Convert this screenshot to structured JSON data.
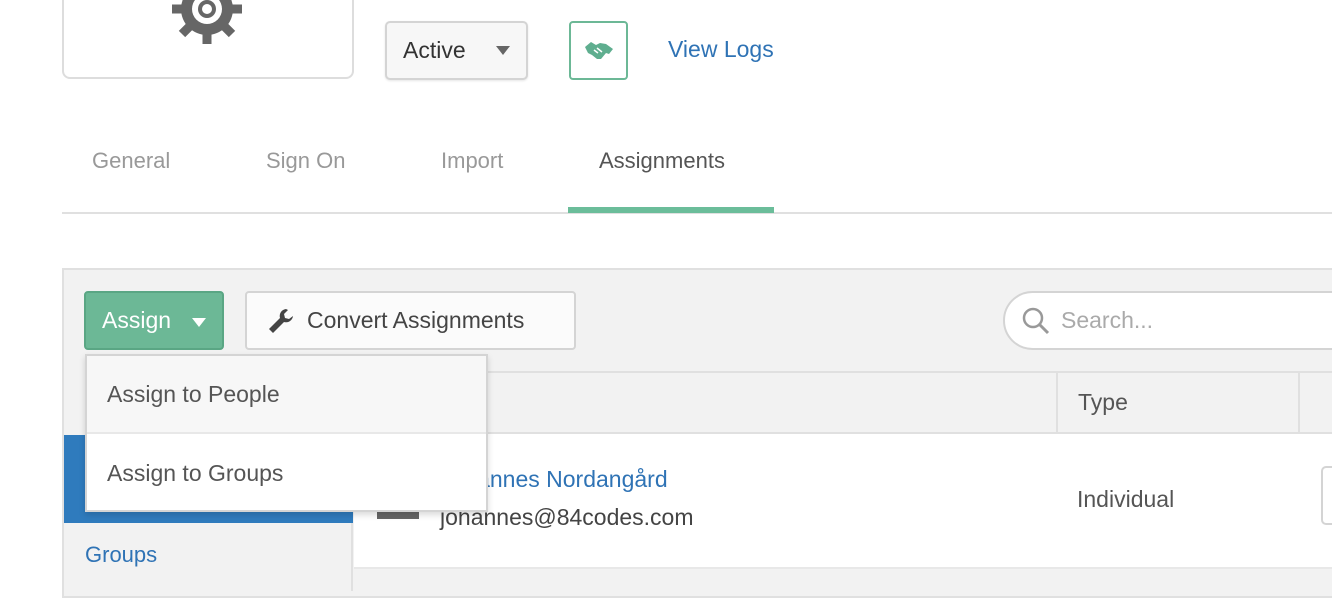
{
  "header": {
    "status_select": "Active",
    "view_logs": "View Logs",
    "icons": {
      "app": "gear-icon",
      "provisioning": "handshake-icon"
    }
  },
  "tabs": [
    {
      "label": "General"
    },
    {
      "label": "Sign On"
    },
    {
      "label": "Import"
    },
    {
      "label": "Assignments",
      "active": true
    }
  ],
  "toolbar": {
    "assign": "Assign",
    "convert": "Convert Assignments",
    "search_placeholder": "Search..."
  },
  "dropdown": {
    "items": [
      "Assign to People",
      "Assign to Groups"
    ]
  },
  "sidebar": {
    "items": [
      {
        "label": "Groups"
      }
    ]
  },
  "table": {
    "headers": [
      "Type"
    ],
    "rows": [
      {
        "name": "Johannes Nordangård",
        "email": "johannes@84codes.com",
        "type": "Individual"
      }
    ]
  },
  "colors": {
    "accent_green": "#6cb896",
    "link_blue": "#2f73b5",
    "selected_blue": "#2f7bbd"
  }
}
